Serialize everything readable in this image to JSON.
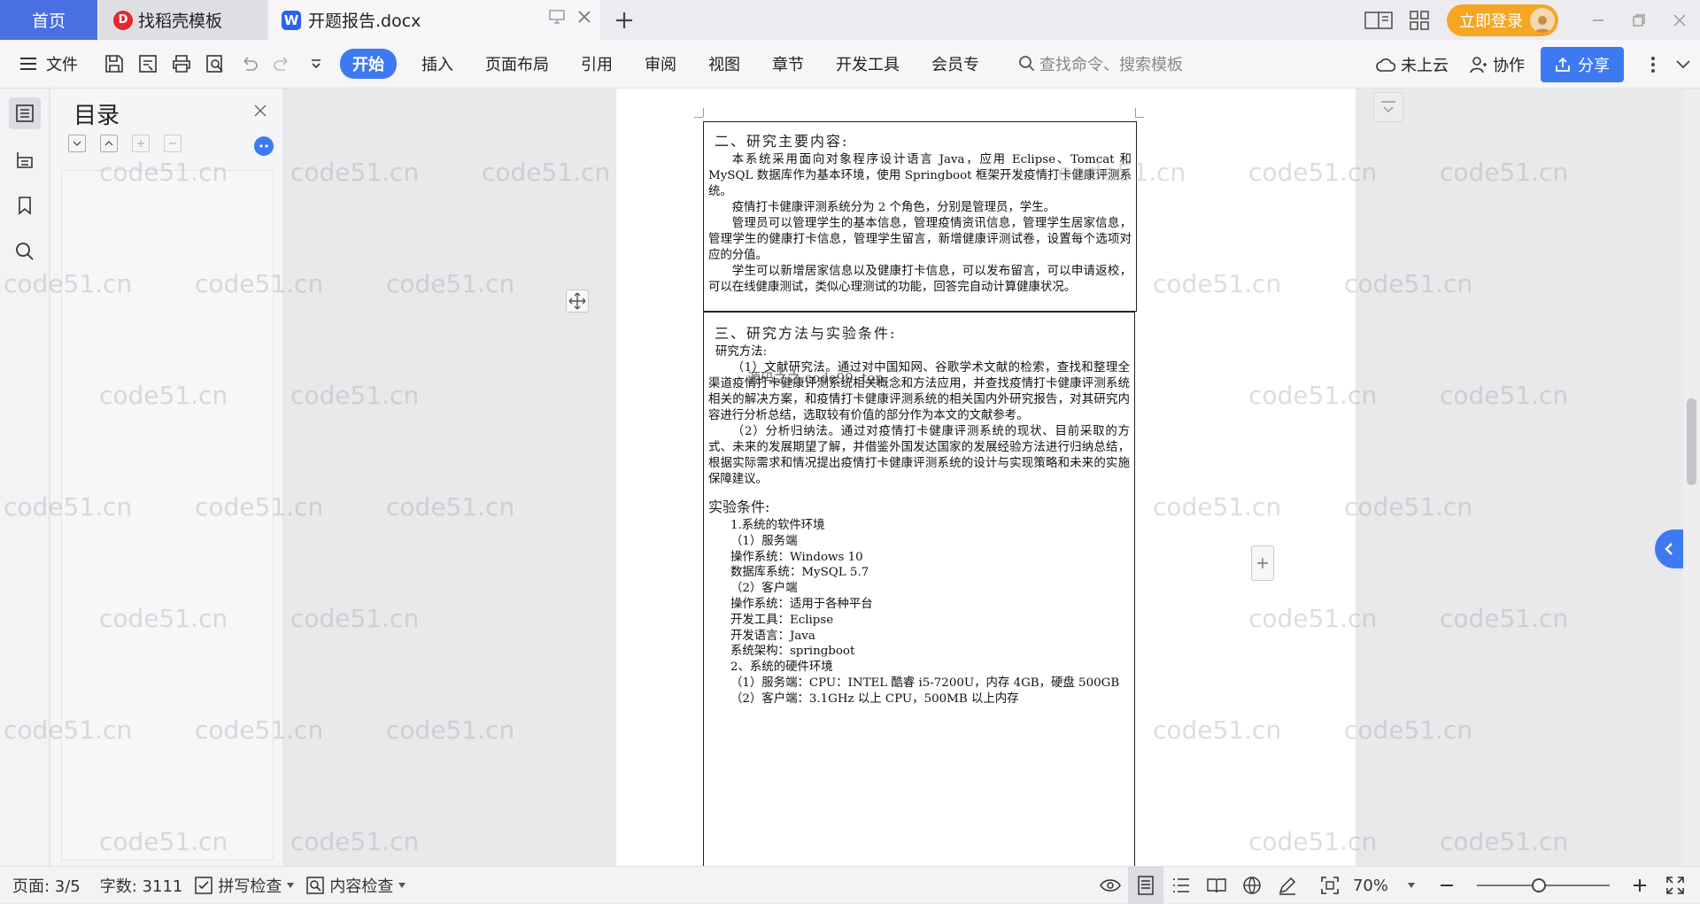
{
  "tabs": {
    "home": "首页",
    "template": "找稻壳模板",
    "doc": "开题报告.docx",
    "login": "立即登录"
  },
  "ribbon": {
    "file": "文件",
    "tabs": [
      "开始",
      "插入",
      "页面布局",
      "引用",
      "审阅",
      "视图",
      "章节",
      "开发工具",
      "会员专"
    ],
    "search_placeholder": "查找命令、搜索模板",
    "cloud": "未上云",
    "collab": "协作",
    "share": "分享"
  },
  "toc": {
    "title": "目录"
  },
  "document": {
    "section2_title": "二、研究主要内容:",
    "section2_paras": [
      "本系统采用面向对象程序设计语言 Java，应用 Eclipse、Tomcat 和 MySQL 数据库作为基本环境，使用 Springboot 框架开发疫情打卡健康评测系统。",
      "疫情打卡健康评测系统分为 2 个角色，分别是管理员，学生。",
      "管理员可以管理学生的基本信息，管理疫情资讯信息，管理学生居家信息，管理学生的健康打卡信息，管理学生留言，新增健康评测试卷，设置每个选项对应的分值。",
      "学生可以新增居家信息以及健康打卡信息，可以发布留言，可以申请返校，可以在线健康测试，类似心理测试的功能，回答完自动计算健康状况。"
    ],
    "section3_title": "三、研究方法与实验条件:",
    "methods_label": "研究方法:",
    "methods_paras": [
      "（1）文献研究法。通过对中国知网、谷歌学术文献的检索，查找和整理全渠道疫情打卡健康评测系统相关概念和方法应用，并查找疫情打卡健康评测系统相关的解决方案，和疫情打卡健康评测系统的相关国内外研究报告，对其研究内容进行分析总结，选取较有价值的部分作为本文的文献参考。",
      "（2）分析归纳法。通过对疫情打卡健康评测系统的现状、目前采取的方式、未来的发展期望了解，并借鉴外国发达国家的发展经验方法进行归纳总结，根据实际需求和情况提出疫情打卡健康评测系统的设计与实现策略和未来的实施保障建议。"
    ],
    "conditions_title": "实验条件:",
    "conditions_lines": [
      "1.系统的软件环境",
      "（1）服务端",
      "操作系统：Windows 10",
      "数据库系统：MySQL 5.7",
      "（2）客户端",
      "操作系统：适用于各种平台",
      "开发工具：Eclipse",
      "开发语言：Java",
      "系统架构：springboot",
      "2、系统的硬件环境",
      "（1）服务端：CPU：INTEL 酷睿 i5-7200U，内存 4GB，硬盘 500GB",
      "（2）客户端：3.1GHz 以上 CPU，500MB 以上内存"
    ],
    "overlay": "源码之之 code99. top"
  },
  "watermark": "code51.cn",
  "status": {
    "page": "页面: 3/5",
    "words": "字数: 3111",
    "spell": "拼写检查",
    "content_check": "内容检查",
    "zoom": "70%"
  },
  "colors": {
    "accent": "#3d7af2",
    "home_tab": "#4a6fe3",
    "login": "#f5a623"
  }
}
